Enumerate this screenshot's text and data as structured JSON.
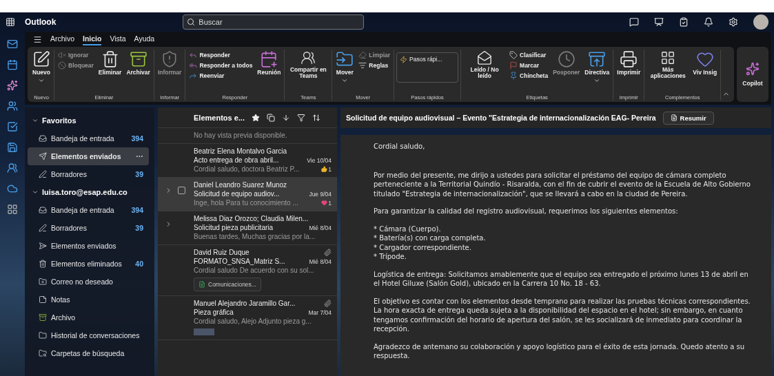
{
  "app_title": "Outlook",
  "search": {
    "placeholder": "Buscar"
  },
  "menu_tabs": [
    {
      "label": "Archivo",
      "selected": false
    },
    {
      "label": "Inicio",
      "selected": true
    },
    {
      "label": "Vista",
      "selected": false
    },
    {
      "label": "Ayuda",
      "selected": false
    }
  ],
  "ribbon_groups": [
    {
      "label": "Nuevo",
      "items": [
        {
          "kind": "large",
          "label": "Nuevo",
          "dropdown": true,
          "disabled": false
        }
      ]
    },
    {
      "label": "Eliminar",
      "items": [
        {
          "kind": "stack",
          "entries": [
            {
              "label": "Ignorar",
              "disabled": true
            },
            {
              "label": "Bloquear",
              "disabled": true
            }
          ]
        },
        {
          "kind": "large",
          "label": "Eliminar",
          "dropdown": false,
          "disabled": false
        },
        {
          "kind": "large",
          "label": "Archivar",
          "dropdown": false,
          "disabled": false
        }
      ]
    },
    {
      "label": "Informar",
      "items": [
        {
          "kind": "large",
          "label": "Informar",
          "dropdown": false,
          "disabled": true
        }
      ]
    },
    {
      "label": "Responder",
      "items": [
        {
          "kind": "stack",
          "entries": [
            {
              "label": "Responder",
              "disabled": false
            },
            {
              "label": "Responder a todos",
              "disabled": false
            },
            {
              "label": "Reenviar",
              "disabled": false
            }
          ]
        },
        {
          "kind": "large",
          "label": "Reunión",
          "dropdown": false,
          "disabled": false
        }
      ]
    },
    {
      "label": "Teams",
      "items": [
        {
          "kind": "large",
          "label": "Compartir en Teams",
          "dropdown": false,
          "disabled": false
        }
      ]
    },
    {
      "label": "Mover",
      "items": [
        {
          "kind": "large",
          "label": "Mover",
          "dropdown": true,
          "disabled": false
        },
        {
          "kind": "stack",
          "entries": [
            {
              "label": "Limpiar",
              "disabled": true
            },
            {
              "label": "Reglas",
              "disabled": false
            }
          ]
        }
      ]
    },
    {
      "label": "Pasos rápidos",
      "items": [
        {
          "kind": "quick",
          "label": "Pasos rápi..."
        }
      ]
    },
    {
      "label": "Etiquetas",
      "items": [
        {
          "kind": "large",
          "label": "Leído / No leído",
          "dropdown": false,
          "disabled": false
        },
        {
          "kind": "stack",
          "entries": [
            {
              "label": "Clasificar",
              "disabled": false
            },
            {
              "label": "Marcar",
              "disabled": false
            },
            {
              "label": "Chincheta",
              "disabled": false
            }
          ]
        },
        {
          "kind": "large",
          "label": "Posponer",
          "dropdown": false,
          "disabled": true
        },
        {
          "kind": "large",
          "label": "Directiva",
          "dropdown": true,
          "disabled": false
        }
      ]
    },
    {
      "label": "Imprimir",
      "items": [
        {
          "kind": "large",
          "label": "Imprimir",
          "dropdown": false,
          "disabled": false
        }
      ]
    },
    {
      "label": "Complementos",
      "items": [
        {
          "kind": "large",
          "label": "Más aplicaciones",
          "dropdown": false,
          "disabled": false
        },
        {
          "kind": "large",
          "label": "Viv Insig",
          "dropdown": false,
          "disabled": false
        }
      ]
    }
  ],
  "copilot": {
    "label": "Copilot"
  },
  "folder_sections": [
    {
      "title": "Favoritos",
      "expanded": true,
      "folders": [
        {
          "kind": "inbox",
          "name": "Bandeja de entrada",
          "count": "394",
          "selected": false
        },
        {
          "kind": "sent",
          "name": "Elementos enviados",
          "count": "···",
          "selected": true
        },
        {
          "kind": "drafts",
          "name": "Borradores",
          "count": "39",
          "selected": false
        }
      ]
    },
    {
      "title": "luisa.toro@esap.edu.co",
      "expanded": true,
      "folders": [
        {
          "kind": "inbox",
          "name": "Bandeja de entrada",
          "count": "394",
          "selected": false
        },
        {
          "kind": "drafts",
          "name": "Borradores",
          "count": "39",
          "selected": false
        },
        {
          "kind": "sentout",
          "name": "Elementos enviados",
          "selected": false
        },
        {
          "kind": "deleted",
          "name": "Elementos eliminados",
          "count": "40",
          "selected": false
        },
        {
          "kind": "junk",
          "name": "Correo no deseado",
          "selected": false
        },
        {
          "kind": "notes",
          "name": "Notas",
          "selected": false
        },
        {
          "kind": "archive",
          "name": "Archivo",
          "selected": false
        },
        {
          "kind": "folder",
          "name": "Historial de conversaciones",
          "selected": false
        },
        {
          "kind": "searchfolder",
          "name": "Carpetas de búsqueda",
          "selected": false
        }
      ]
    }
  ],
  "message_list": {
    "title": "Elementos e...",
    "messages": [
      {
        "preview": "No hay vista previa disponible.",
        "selected": false,
        "expandable": false
      },
      {
        "sender": "Beatriz Elena Montalvo Garcia",
        "subject": "Acto entrega de obra abril...",
        "date": "Vie 10/04",
        "preview": "Cordial saludo, doctora Beatriz P...",
        "reaction": {
          "kind": "like",
          "count": "1"
        },
        "selected": false,
        "expandable": false
      },
      {
        "sender": "Daniel Leandro Suarez Munoz",
        "subject": "Solicitud de equipo audiov...",
        "date": "Jue 9/04",
        "preview": "Inge, hola Para tu conocimiento ...",
        "reaction": {
          "kind": "heart",
          "count": "1"
        },
        "selected": true,
        "expandable": true,
        "checked": false
      },
      {
        "sender": "Melissa Diaz Orozco; Claudia Milen...",
        "subject": "Solicitud pieza publicitaria",
        "date": "Mié 8/04",
        "preview": "Buenas tardes, Muchas gracias por la...",
        "selected": false,
        "expandable": true
      },
      {
        "sender": "David Ruiz Duque",
        "subject": "FORMATO_SNSA_Matriz S...",
        "date": "Mié 8/04",
        "preview": "Cordial saludo De acuerdo con su sol...",
        "attachment": true,
        "chip": "Comunicaciones...",
        "selected": false,
        "expandable": false
      },
      {
        "sender": "Manuel Alejandro Jaramillo Gar...",
        "subject": "Pieza gráfica",
        "date": "Mar 7/04",
        "preview": "Cordial saludo, Alejo Adjunto pieza g...",
        "attachment": true,
        "thumbnail": true,
        "selected": false,
        "expandable": false
      }
    ]
  },
  "reading_pane": {
    "subject": "Solicitud de equipo audiovisual – Evento \"Estrategia de internacionalización EAG- Pereira",
    "summarize": "Resumir",
    "body": [
      "Cordial saludo,",
      "Por medio del presente, me dirijo a ustedes para solicitar el préstamo del equipo de cámara completo perteneciente a la Territorial Quindío - Risaralda, con el fin de cubrir el evento de la Escuela de Alto Gobierno titulado \"Estrategia de internacionalización\", que se llevará a cabo en la ciudad de Pereira.",
      "Para garantizar la calidad del registro audiovisual, requerimos los siguientes elementos:",
      "* Cámara (Cuerpo).\n* Batería(s) con carga completa.\n* Cargador correspondiente.\n* Trípode.",
      "Logística de entrega: Solicitamos amablemente que el equipo sea entregado el próximo lunes 13 de abril en el Hotel Giluxe (Salón Gold), ubicado en la Carrera 10 No. 18 - 63.",
      "El objetivo es contar con los elementos desde temprano para realizar las pruebas técnicas correspondientes. La hora exacta de entrega queda sujeta a la disponibilidad del espacio en el hotel; sin embargo, en cuanto tengamos confirmación del horario de apertura del salón, se les socializará de inmediato para coordinar la recepción.",
      "Agradezco de antemano su colaboración y apoyo logístico para el éxito de esta jornada. Quedo atento a su respuesta."
    ]
  }
}
